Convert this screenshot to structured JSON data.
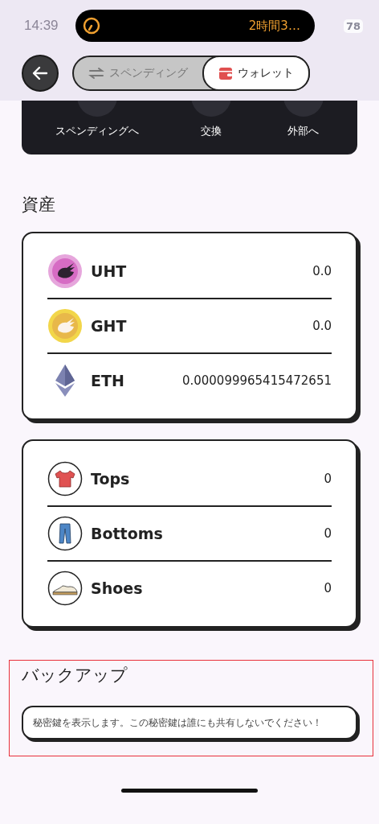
{
  "status_bar": {
    "time": "14:39",
    "activity": "2時間3…",
    "battery": "78"
  },
  "tabs": [
    {
      "label": "スペンディング",
      "selected": false
    },
    {
      "label": "ウォレット",
      "selected": true
    }
  ],
  "actions": [
    {
      "label": "スペンディングへ"
    },
    {
      "label": "交換"
    },
    {
      "label": "外部へ"
    }
  ],
  "assets": {
    "title": "資産",
    "tokens": [
      {
        "kind": "uht",
        "symbol": "UHT",
        "amount": "0.0"
      },
      {
        "kind": "ght",
        "symbol": "GHT",
        "amount": "0.0"
      },
      {
        "kind": "eth",
        "symbol": "ETH",
        "amount": "0.000099965415472651"
      }
    ],
    "items": [
      {
        "kind": "tops",
        "name": "Tops",
        "count": "0"
      },
      {
        "kind": "bottoms",
        "name": "Bottoms",
        "count": "0"
      },
      {
        "kind": "shoes",
        "name": "Shoes",
        "count": "0"
      }
    ]
  },
  "backup": {
    "title": "バックアップ",
    "highlighted": true,
    "message": "秘密鍵を表示します。この秘密鍵は誰にも共有しないでください！"
  }
}
